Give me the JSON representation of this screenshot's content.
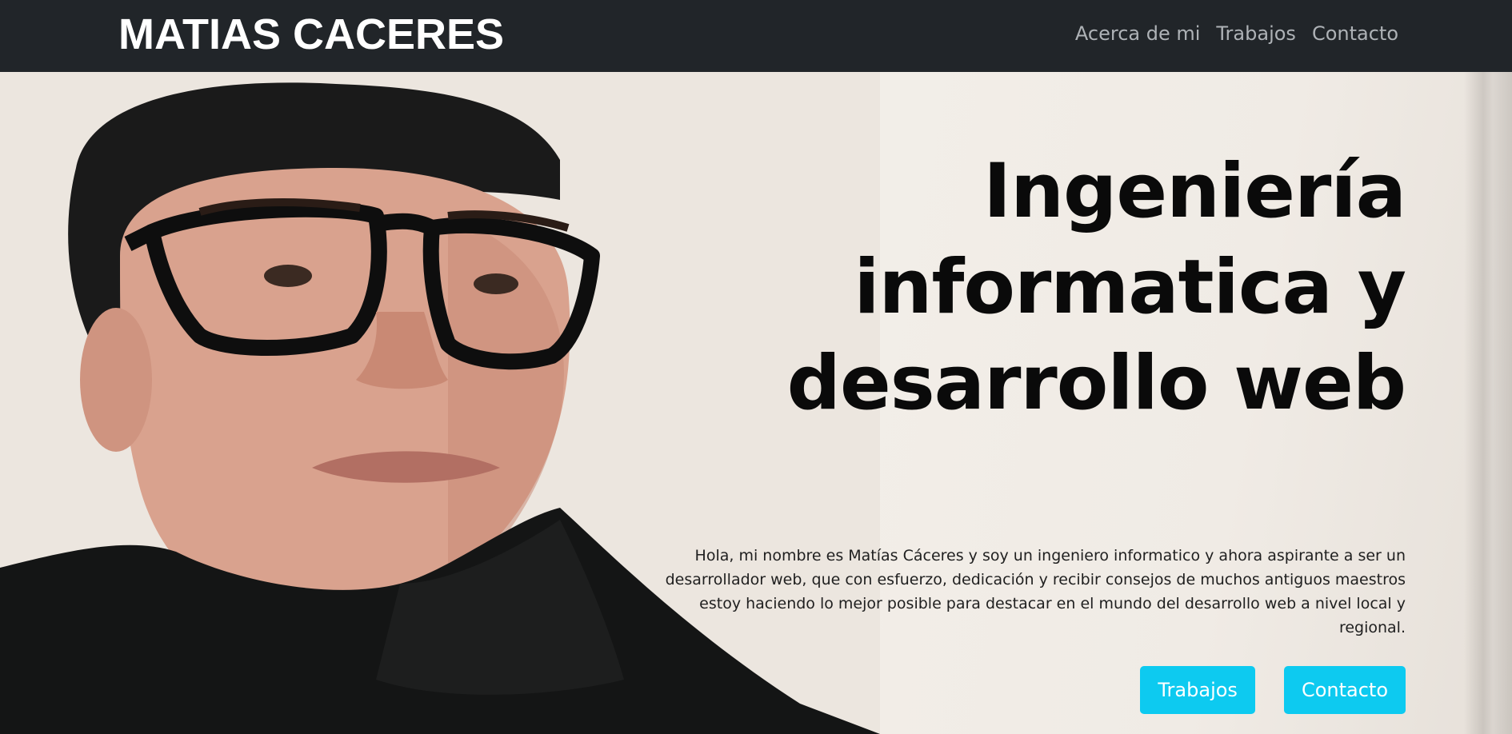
{
  "navbar": {
    "brand": "MATIAS CACERES",
    "links": [
      {
        "label": "Acerca de mi"
      },
      {
        "label": "Trabajos"
      },
      {
        "label": "Contacto"
      }
    ]
  },
  "hero": {
    "title_lines": [
      "Ingeniería",
      "informatica y",
      "desarrollo web"
    ],
    "text_lines": [
      "Hola, mi nombre es Matías Cáceres y soy un ingeniero informatico y ahora aspirante a ser un",
      "desarrollador web, que con esfuerzo, dedicación y recibir consejos de muchos antiguos maestros",
      "estoy haciendo lo mejor posible para destacar en el mundo del desarrollo web a nivel local y regional."
    ],
    "buttons": [
      {
        "label": "Trabajos"
      },
      {
        "label": "Contacto"
      }
    ]
  },
  "colors": {
    "navbar_bg": "#212529",
    "nav_link": "#aeb2b6",
    "button_bg": "#0dcaf0",
    "button_text": "#ffffff",
    "title_text": "#0a0a0a"
  }
}
